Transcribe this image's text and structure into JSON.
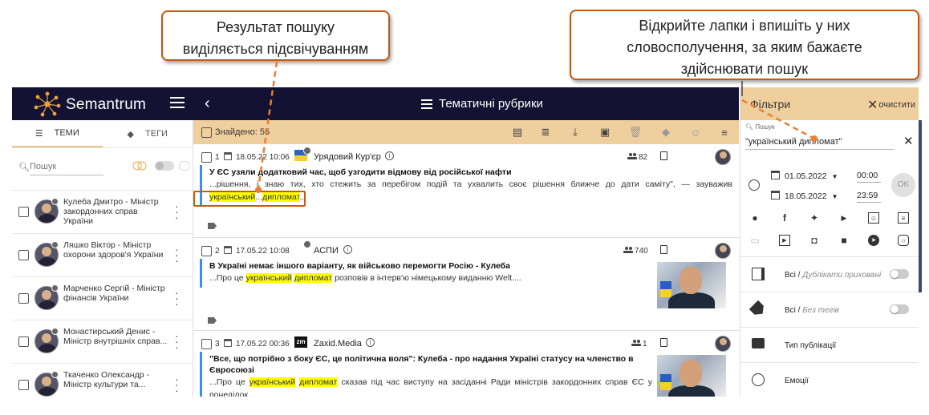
{
  "callouts": {
    "left": [
      "Результат пошуку",
      "виділяється підсвічуванням"
    ],
    "right": [
      "Відкрийте лапки і впишіть у них",
      "словосполучення, за яким бажаєте",
      "здійснювати пошук"
    ],
    "border_color": "#c55a11"
  },
  "app": {
    "logo": "Semantrum",
    "header_title": "Тематичні рубрики",
    "icons": {
      "menu": "hamburger-icon",
      "back": "chevron-left-icon"
    }
  },
  "sidebar": {
    "tabs": [
      {
        "label": "ТЕМИ",
        "icon": "list-icon",
        "active": true
      },
      {
        "label": "ТЕГИ",
        "icon": "tag-icon",
        "active": false
      }
    ],
    "search_placeholder": "Пошук",
    "people": [
      {
        "name": "Кулеба Дмитро - Міністр закордонних справ України"
      },
      {
        "name": "Ляшко Віктор - Міністр охорони здоров'я України"
      },
      {
        "name": "Марченко Сергій - Міністр фінансів України"
      },
      {
        "name": "Монастирський Денис - Міністр внутрішніх справ..."
      },
      {
        "name": "Ткаченко Олександр - Міністр культури та..."
      }
    ]
  },
  "toolbar": {
    "found": "Знайдено: 55",
    "icons": [
      "document-icon",
      "text-list-icon",
      "download-icon",
      "save-icon",
      "delete-icon",
      "tag-icon",
      "emoji-icon",
      "filter-sort-icon"
    ]
  },
  "articles": [
    {
      "num": "1",
      "date": "18.05.22 10:06",
      "source": "Урядовий Кур'єр",
      "audience": "82",
      "title": "У ЄС узяли додатковий час, щоб узгодити відмову від російської нафти",
      "text_before": "...рішення, і знаю тих, хто стежить за перебігом подій та ухвалить своє рішення ближче до дати саміту\", — зауважив ",
      "hl1": "український",
      "mid": "...",
      "hl2": "дипломат",
      "text_after": "..."
    },
    {
      "num": "2",
      "date": "17.05.22 10:08",
      "source": "АСПИ",
      "audience": "740",
      "title": "В Україні немає іншого варіанту, як військово перемогти Росію - Кулеба",
      "text_before": "...Про це ",
      "hl1": "український",
      "mid": " ",
      "hl2": "дипломат",
      "text_after": " розповів в інтерв'ю німецькому виданню Welt...."
    },
    {
      "num": "3",
      "date": "17.05.22 00:36",
      "source": "Zaxid.Media",
      "audience": "1",
      "title": "\"Все, що потрібно з боку ЄС, це політична воля\": Кулеба - про надання Україні статусу на членство в Євросоюзі",
      "text_before": "...Про це ",
      "hl1": "український",
      "mid": " ",
      "hl2": "дипломат",
      "text_after": " сказав під час виступу на засіданні Ради міністрів закордонних справ ЄС у понеділок..."
    }
  ],
  "filters": {
    "title": "Фільтри",
    "clear": "очистити",
    "search_label": "Пошук",
    "search_value": "\"український дипломат\"",
    "date_from": "01.05.2022",
    "time_from": "00:00",
    "date_to": "18.05.2022",
    "time_to": "23:59",
    "ok": "OK",
    "channels_row1": [
      "globe-icon",
      "facebook-icon",
      "twitter-icon",
      "youtube-icon",
      "vk-icon",
      "news-icon"
    ],
    "channels_row2": [
      "forum-icon",
      "video-icon",
      "radio-icon",
      "chat-icon",
      "telegram-icon",
      "instagram-icon"
    ],
    "rows": [
      {
        "label": "Всі",
        "sub": "Дублікати приховані",
        "icon": "duplicates-icon",
        "toggle": true
      },
      {
        "label": "Всі",
        "sub": "Без тегів",
        "icon": "tag-icon",
        "toggle": true
      },
      {
        "label": "Тип публікації",
        "sub": "",
        "icon": "publication-type-icon",
        "toggle": false
      },
      {
        "label": "Емоції",
        "sub": "",
        "icon": "emoji-icon",
        "toggle": false
      }
    ]
  }
}
